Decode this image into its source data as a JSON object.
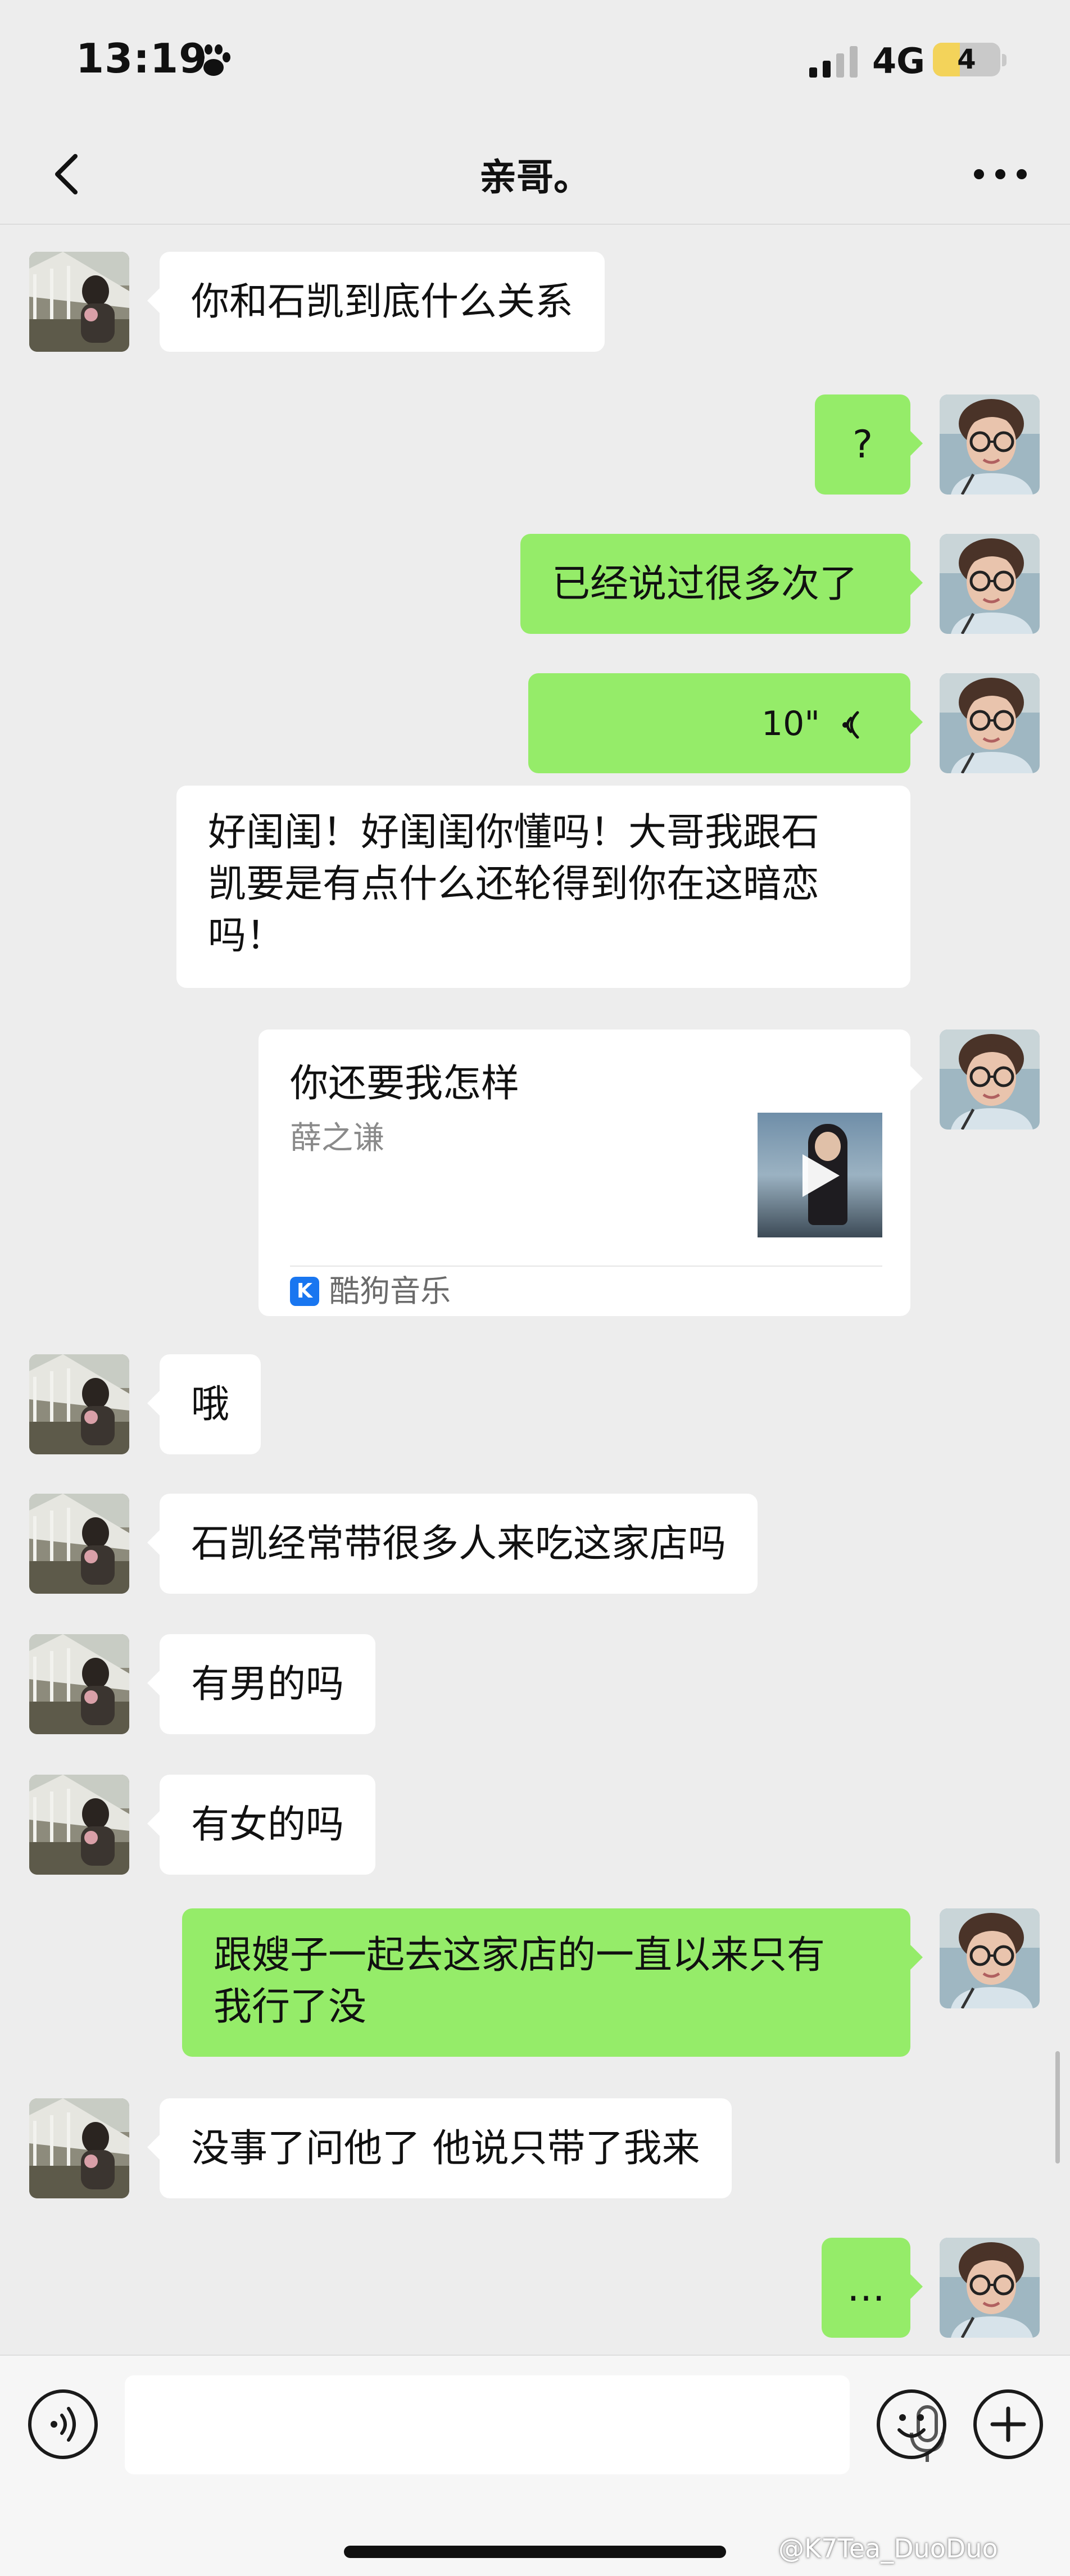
{
  "status_bar": {
    "time": "13:19",
    "network": "4G",
    "battery": "4",
    "battery_level": 0.4
  },
  "header": {
    "title": "亲哥。",
    "back_icon": "chevron-left-icon",
    "more_icon": "more-dots-icon"
  },
  "messages": [
    {
      "side": "left",
      "type": "text",
      "text": "你和石凯到底什么关系"
    },
    {
      "side": "right",
      "type": "text",
      "text": "?"
    },
    {
      "side": "right",
      "type": "text",
      "text": "已经说过很多次了"
    },
    {
      "side": "right",
      "type": "voice",
      "duration": "10\""
    },
    {
      "side": "left",
      "type": "text",
      "lines": [
        "好闺闺！好闺闺你懂吗！大哥我跟石",
        "凯要是有点什么还轮得到你在这暗恋",
        "吗！"
      ]
    },
    {
      "side": "right",
      "type": "music",
      "song": "你还要我怎样",
      "artist": "薛之谦",
      "app": "酷狗音乐"
    },
    {
      "side": "left",
      "type": "text",
      "text": "哦"
    },
    {
      "side": "left",
      "type": "text",
      "text": "石凯经常带很多人来吃这家店吗"
    },
    {
      "side": "left",
      "type": "text",
      "text": "有男的吗"
    },
    {
      "side": "left",
      "type": "text",
      "text": "有女的吗"
    },
    {
      "side": "right",
      "type": "text",
      "lines": [
        "跟嫂子一起去这家店的一直以来只有",
        "我行了没"
      ]
    },
    {
      "side": "left",
      "type": "text",
      "text": "没事了问他了 他说只带了我来"
    },
    {
      "side": "right",
      "type": "text",
      "text": "…"
    }
  ],
  "input_bar": {
    "voice_icon": "voice-input-icon",
    "mic_icon": "microphone-icon",
    "emoji_icon": "emoji-icon",
    "plus_icon": "plus-icon"
  },
  "watermark": "@K7Tea_DuoDuo",
  "colors": {
    "background": "#ededed",
    "outgoing_bubble": "#95ec69",
    "incoming_bubble": "#ffffff"
  }
}
